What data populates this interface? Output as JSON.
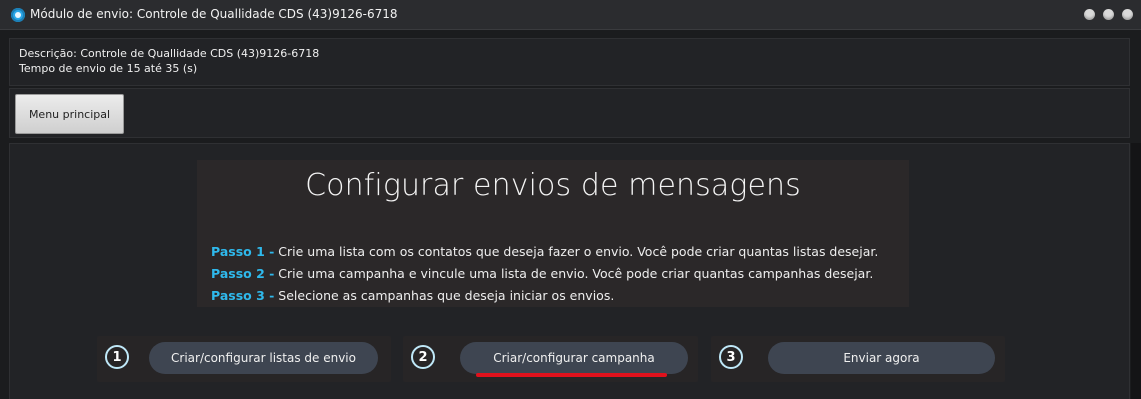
{
  "window": {
    "title": "Módulo de envio: Controle de Quallidade CDS (43)9126-6718"
  },
  "description": {
    "line1": "Descrição: Controle de Quallidade CDS (43)9126-6718",
    "line2": "Tempo de envio de 15 até 35 (s)"
  },
  "menu": {
    "main_button": "Menu principal"
  },
  "content": {
    "heading": "Configurar envios de mensagens",
    "steps": [
      {
        "tag": "Passo 1 -",
        "text": " Crie uma lista com os contatos que deseja fazer o envio. Você pode criar quantas listas desejar."
      },
      {
        "tag": "Passo 2 -",
        "text": " Crie uma campanha e vincule uma lista de envio. Você pode criar quantas campanhas desejar."
      },
      {
        "tag": "Passo 3 -",
        "text": " Selecione as campanhas que deseja iniciar os envios."
      }
    ]
  },
  "actions": [
    {
      "number": "1",
      "label": "Criar/configurar listas de envio"
    },
    {
      "number": "2",
      "label": "Criar/configurar campanha"
    },
    {
      "number": "3",
      "label": "Enviar agora"
    }
  ],
  "colors": {
    "accent": "#2fb9ec",
    "highlight": "#e0111c",
    "button_bg": "#3e4551"
  }
}
